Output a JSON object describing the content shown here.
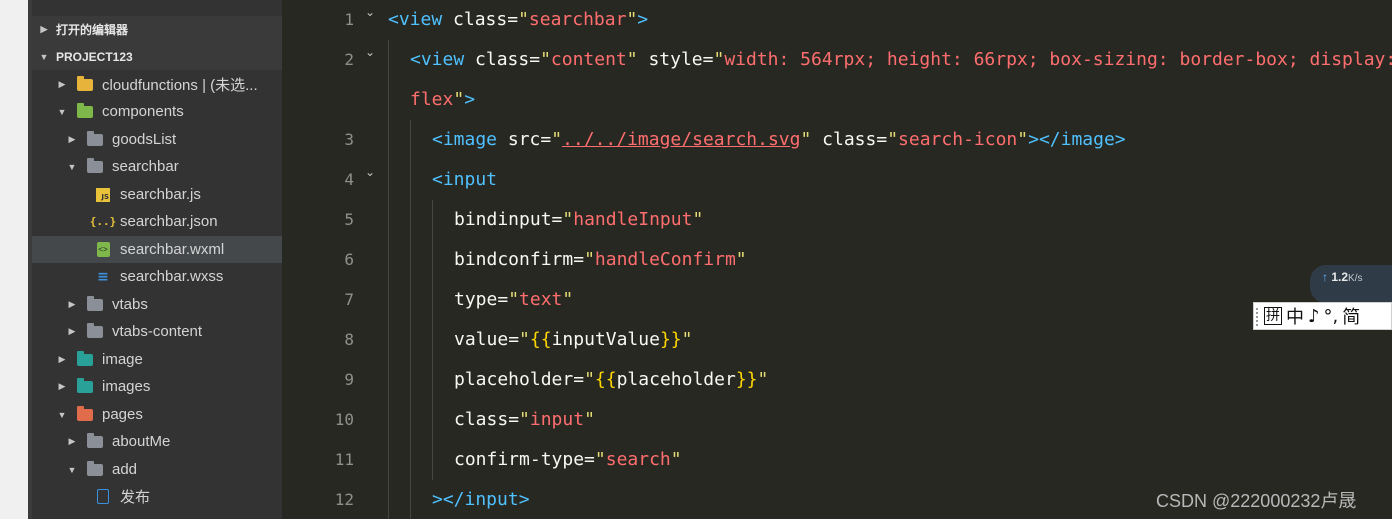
{
  "sidebar": {
    "sections": [
      {
        "label": "打开的编辑器",
        "expanded": false
      },
      {
        "label": "PROJECT123",
        "expanded": true
      }
    ],
    "items": [
      {
        "label": "cloudfunctions | (未选...",
        "icon": "folder-cloud-icon",
        "expanded": false
      },
      {
        "label": "components",
        "icon": "folder-components-icon",
        "expanded": true
      },
      {
        "label": "goodsList",
        "icon": "folder-icon",
        "expanded": false
      },
      {
        "label": "searchbar",
        "icon": "folder-open-icon",
        "expanded": true
      },
      {
        "label": "searchbar.js",
        "icon": "js-file-icon"
      },
      {
        "label": "searchbar.json",
        "icon": "json-file-icon"
      },
      {
        "label": "searchbar.wxml",
        "icon": "wxml-file-icon",
        "selected": true
      },
      {
        "label": "searchbar.wxss",
        "icon": "wxss-file-icon"
      },
      {
        "label": "vtabs",
        "icon": "folder-icon",
        "expanded": false
      },
      {
        "label": "vtabs-content",
        "icon": "folder-icon",
        "expanded": false
      },
      {
        "label": "image",
        "icon": "folder-image-icon",
        "expanded": false
      },
      {
        "label": "images",
        "icon": "folder-image-icon",
        "expanded": false
      },
      {
        "label": "pages",
        "icon": "folder-pages-icon",
        "expanded": true
      },
      {
        "label": "aboutMe",
        "icon": "folder-icon",
        "expanded": false
      },
      {
        "label": "add",
        "icon": "folder-open-icon",
        "expanded": true
      },
      {
        "label": "发布",
        "icon": "file-icon"
      }
    ],
    "colors": {
      "background": "#333333",
      "selected": "#45484b",
      "text": "#d4d4d4"
    }
  },
  "editor": {
    "line_numbers": [
      "1",
      "2",
      "",
      "3",
      "4",
      "5",
      "6",
      "7",
      "8",
      "9",
      "10",
      "11",
      "12"
    ],
    "lines": [
      {
        "tokens": [
          [
            "t-tag",
            "<view "
          ],
          [
            "t-attr",
            "class"
          ],
          [
            "t-eq",
            "="
          ],
          [
            "t-q",
            "\""
          ],
          [
            "t-str",
            "searchbar"
          ],
          [
            "t-q",
            "\""
          ],
          [
            "t-tag",
            ">"
          ]
        ]
      },
      {
        "tokens": [
          [
            "t-tag",
            "<view "
          ],
          [
            "t-attr",
            "class"
          ],
          [
            "t-eq",
            "="
          ],
          [
            "t-q",
            "\""
          ],
          [
            "t-str",
            "content"
          ],
          [
            "t-q",
            "\""
          ],
          [
            "t-attr",
            " style"
          ],
          [
            "t-eq",
            "="
          ],
          [
            "t-q",
            "\""
          ],
          [
            "t-str",
            "width: 564rpx; height: 66rpx; box-sizing: border-box; display:"
          ]
        ]
      },
      {
        "tokens": [
          [
            "t-str",
            "flex"
          ],
          [
            "t-q",
            "\""
          ],
          [
            "t-tag",
            ">"
          ]
        ]
      },
      {
        "tokens": [
          [
            "t-tag",
            "<image "
          ],
          [
            "t-attr",
            "src"
          ],
          [
            "t-eq",
            "="
          ],
          [
            "t-q",
            "\""
          ],
          [
            "t-str u",
            "../../image/search.svg"
          ],
          [
            "t-q",
            "\""
          ],
          [
            "t-attr",
            " class"
          ],
          [
            "t-eq",
            "="
          ],
          [
            "t-q",
            "\""
          ],
          [
            "t-str",
            "search-icon"
          ],
          [
            "t-q",
            "\""
          ],
          [
            "t-tag",
            "></image>"
          ]
        ]
      },
      {
        "tokens": [
          [
            "t-tag",
            "<input"
          ]
        ]
      },
      {
        "tokens": [
          [
            "t-attr",
            "bindinput"
          ],
          [
            "t-eq",
            "="
          ],
          [
            "t-q",
            "\""
          ],
          [
            "t-str",
            "handleInput"
          ],
          [
            "t-q",
            "\""
          ]
        ]
      },
      {
        "tokens": [
          [
            "t-attr",
            "bindconfirm"
          ],
          [
            "t-eq",
            "="
          ],
          [
            "t-q",
            "\""
          ],
          [
            "t-str",
            "handleConfirm"
          ],
          [
            "t-q",
            "\""
          ]
        ]
      },
      {
        "tokens": [
          [
            "t-attr",
            "type"
          ],
          [
            "t-eq",
            "="
          ],
          [
            "t-q",
            "\""
          ],
          [
            "t-str",
            "text"
          ],
          [
            "t-q",
            "\""
          ]
        ]
      },
      {
        "tokens": [
          [
            "t-attr",
            "value"
          ],
          [
            "t-eq",
            "="
          ],
          [
            "t-q",
            "\""
          ],
          [
            "t-brace",
            "{{"
          ],
          [
            "t-var",
            "inputValue"
          ],
          [
            "t-brace",
            "}}"
          ],
          [
            "t-q",
            "\""
          ]
        ]
      },
      {
        "tokens": [
          [
            "t-attr",
            "placeholder"
          ],
          [
            "t-eq",
            "="
          ],
          [
            "t-q",
            "\""
          ],
          [
            "t-brace",
            "{{"
          ],
          [
            "t-var",
            "placeholder"
          ],
          [
            "t-brace",
            "}}"
          ],
          [
            "t-q",
            "\""
          ]
        ]
      },
      {
        "tokens": [
          [
            "t-attr",
            "class"
          ],
          [
            "t-eq",
            "="
          ],
          [
            "t-q",
            "\""
          ],
          [
            "t-str",
            "input"
          ],
          [
            "t-q",
            "\""
          ]
        ]
      },
      {
        "tokens": [
          [
            "t-attr",
            "confirm-type"
          ],
          [
            "t-eq",
            "="
          ],
          [
            "t-q",
            "\""
          ],
          [
            "t-str",
            "search"
          ],
          [
            "t-q",
            "\""
          ]
        ]
      },
      {
        "tokens": [
          [
            "t-tag",
            "></input>"
          ]
        ]
      }
    ],
    "colors": {
      "background": "#272822",
      "tag": "#4fc1ff",
      "string": "#ff6e6e",
      "brace": "#ffd700"
    }
  },
  "overlays": {
    "net_speed": {
      "value": "1.2",
      "unit": "K/s",
      "arrow": "↑"
    },
    "ime": {
      "items": [
        "拼",
        "中",
        "♪",
        "°,",
        "简"
      ]
    },
    "watermark": "CSDN @222000232卢晟"
  }
}
